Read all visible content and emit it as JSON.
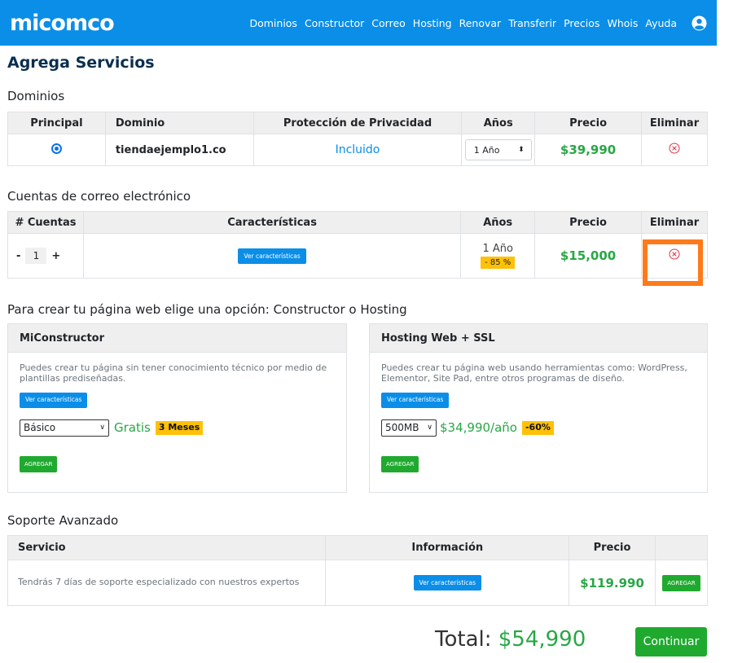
{
  "brand": {
    "logo_text_pre": "mi",
    "logo_text_mid": "com",
    "logo_text_post": "co"
  },
  "nav": {
    "links": [
      "Dominios",
      "Constructor",
      "Correo",
      "Hosting",
      "Renovar",
      "Transferir",
      "Precios",
      "Whois",
      "Ayuda"
    ],
    "user_icon": "user-circle-icon"
  },
  "page_title": "Agrega Servicios",
  "domains": {
    "title": "Dominios",
    "headers": [
      "Principal",
      "Dominio",
      "Protección de Privacidad",
      "Años",
      "Precio",
      "Eliminar"
    ],
    "row": {
      "domain": "tiendaejemplo1.co",
      "privacy": "Incluido",
      "years": "1 Año",
      "price": "$39,990"
    }
  },
  "email": {
    "title": "Cuentas de correo electrónico",
    "headers": [
      "# Cuentas",
      "Características",
      "Años",
      "Precio",
      "Eliminar"
    ],
    "row": {
      "minus": "-",
      "qty": "1",
      "plus": "+",
      "features_btn": "Ver características",
      "years": "1 Año",
      "discount": "- 85 %",
      "price": "$15,000"
    }
  },
  "website": {
    "title": "Para crear tu página web elige una opción: Constructor o Hosting",
    "constructor": {
      "header": "MiConstructor",
      "desc": "Puedes crear tu página sin tener conocimiento técnico por medio de plantillas prediseñadas.",
      "features_btn": "Ver características",
      "plan": "Básico",
      "price": "Gratis",
      "badge": "3 Meses",
      "add_btn": "AGREGAR"
    },
    "hosting": {
      "header": "Hosting Web + SSL",
      "desc": "Puedes crear tu página web usando herramientas como: WordPress, Elementor, Site Pad, entre otros programas de diseño.",
      "features_btn": "Ver características",
      "plan": "500MB",
      "price": "$34,990/año",
      "badge": "-60%",
      "add_btn": "AGREGAR"
    }
  },
  "support": {
    "title": "Soporte Avanzado",
    "headers": [
      "Servicio",
      "Información",
      "Precio",
      ""
    ],
    "row": {
      "service": "Tendrás 7 días de soporte especializado con nuestros expertos",
      "features_btn": "Ver características",
      "price": "$119.990",
      "add_btn": "AGREGAR"
    }
  },
  "footer": {
    "total_label": "Total:",
    "total_value": "$54,990",
    "continue_btn": "Continuar"
  },
  "colors": {
    "primary": "#0a8ee8",
    "success": "#1faa2f",
    "price_green": "#28a745",
    "warning": "#ffc107",
    "highlight": "#ff7a1a",
    "title_navy": "#0b2e4f"
  }
}
